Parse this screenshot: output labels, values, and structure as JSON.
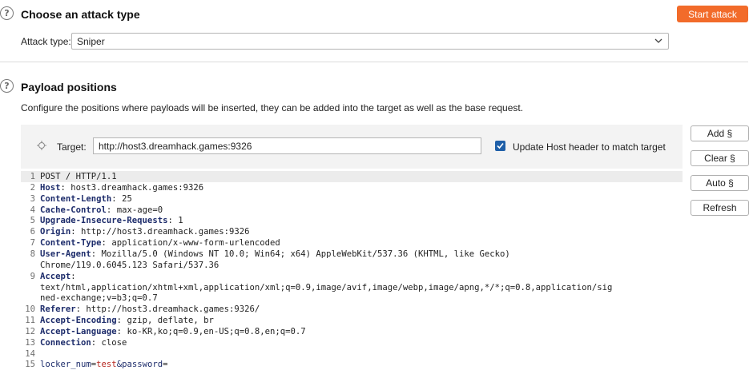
{
  "attack": {
    "title": "Choose an attack type",
    "start_label": "Start attack",
    "type_label": "Attack type:",
    "type_value": "Sniper"
  },
  "payload": {
    "title": "Payload positions",
    "description": "Configure the positions where payloads will be inserted, they can be added into the target as well as the base request.",
    "target_label": "Target:",
    "target_value": "http://host3.dreamhack.games:9326",
    "update_host_label": "Update Host header to match target",
    "update_host_checked": true
  },
  "buttons": {
    "add": "Add §",
    "clear": "Clear §",
    "auto": "Auto §",
    "refresh": "Refresh"
  },
  "request": {
    "lines": [
      {
        "n": "1",
        "text": "POST / HTTP/1.1"
      },
      {
        "n": "2",
        "name": "Host",
        "value": " host3.dreamhack.games:9326"
      },
      {
        "n": "3",
        "name": "Content-Length",
        "value": " 25"
      },
      {
        "n": "4",
        "name": "Cache-Control",
        "value": " max-age=0"
      },
      {
        "n": "5",
        "name": "Upgrade-Insecure-Requests",
        "value": " 1"
      },
      {
        "n": "6",
        "name": "Origin",
        "value": " http://host3.dreamhack.games:9326"
      },
      {
        "n": "7",
        "name": "Content-Type",
        "value": " application/x-www-form-urlencoded"
      },
      {
        "n": "8",
        "name": "User-Agent",
        "value": " Mozilla/5.0 (Windows NT 10.0; Win64; x64) AppleWebKit/537.36 (KHTML, like Gecko)"
      },
      {
        "n": "",
        "text": "Chrome/119.0.6045.123 Safari/537.36"
      },
      {
        "n": "9",
        "name": "Accept",
        "value": ""
      },
      {
        "n": "",
        "text": "text/html,application/xhtml+xml,application/xml;q=0.9,image/avif,image/webp,image/apng,*/*;q=0.8,application/sig"
      },
      {
        "n": "",
        "text": "ned-exchange;v=b3;q=0.7"
      },
      {
        "n": "10",
        "name": "Referer",
        "value": " http://host3.dreamhack.games:9326/"
      },
      {
        "n": "11",
        "name": "Accept-Encoding",
        "value": " gzip, deflate, br"
      },
      {
        "n": "12",
        "name": "Accept-Language",
        "value": " ko-KR,ko;q=0.9,en-US;q=0.8,en;q=0.7"
      },
      {
        "n": "13",
        "name": "Connection",
        "value": " close"
      },
      {
        "n": "14",
        "text": ""
      },
      {
        "n": "15",
        "body": [
          {
            "k": "locker_num",
            "sep": "=",
            "v": "test"
          },
          {
            "k": "&password",
            "sep": "=",
            "v": ""
          }
        ]
      }
    ]
  }
}
